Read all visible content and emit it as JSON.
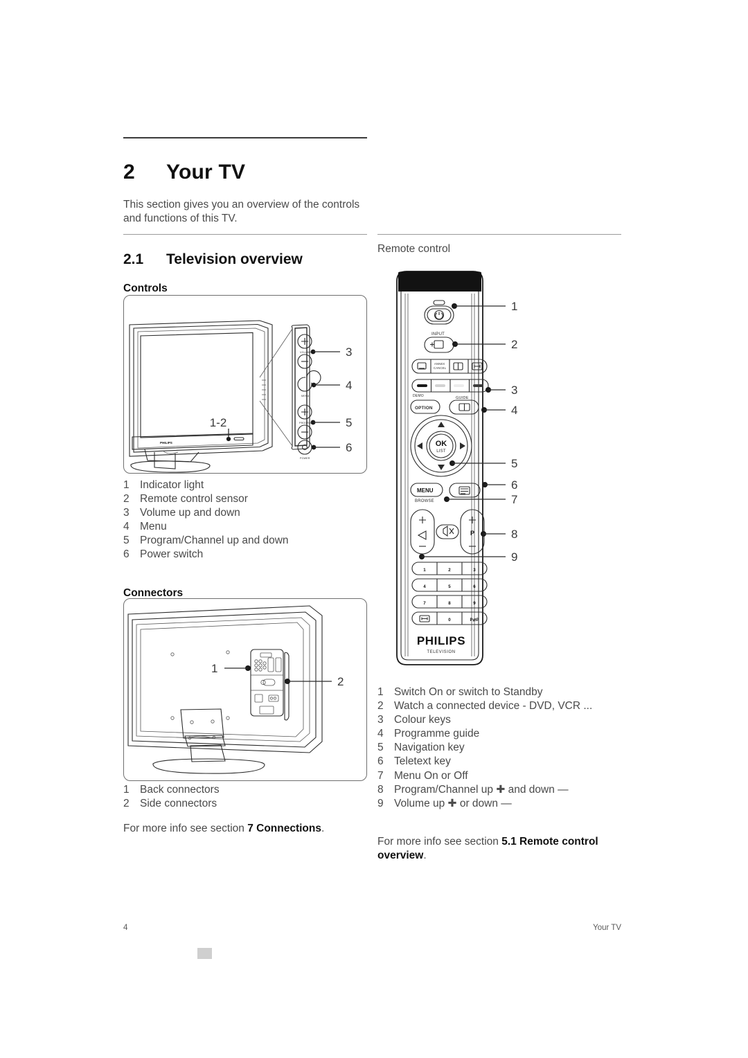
{
  "document": {
    "chapter_number": "2",
    "chapter_title": "Your TV",
    "intro": "This section gives you an overview of the controls and functions of this TV.",
    "section_number": "2.1",
    "section_title": "Television overview"
  },
  "left_column": {
    "controls_heading": "Controls",
    "connectors_heading": "Connectors",
    "controls_figure": {
      "brand": "PHILIPS",
      "callout_group_label": "1-2",
      "button_labels": [
        "VOLUME",
        "MENU",
        "PROGRAM",
        "POWER"
      ],
      "callouts": [
        "3",
        "4",
        "5",
        "6"
      ]
    },
    "connectors_figure": {
      "callouts": [
        "1",
        "2"
      ]
    },
    "controls_list": [
      {
        "num": "1",
        "label": "Indicator light"
      },
      {
        "num": "2",
        "label": "Remote control sensor"
      },
      {
        "num": "3",
        "label": "Volume up and down"
      },
      {
        "num": "4",
        "label": "Menu"
      },
      {
        "num": "5",
        "label": "Program/Channel up and down"
      },
      {
        "num": "6",
        "label": "Power switch"
      }
    ],
    "connectors_list": [
      {
        "num": "1",
        "label": "Back connectors"
      },
      {
        "num": "2",
        "label": "Side connectors"
      }
    ],
    "connectors_seealso_prefix": "For more info see section ",
    "connectors_seealso_bold": "7 Connections",
    "connectors_seealso_suffix": "."
  },
  "right_column": {
    "remote_heading": "Remote control",
    "remote_figure": {
      "brand": "PHILIPS",
      "brand_sub": "TELEVISION",
      "ok_label": "OK",
      "ok_sub": "LIST",
      "input_label": "INPUT",
      "guide_label": "GUIDE",
      "option_label": "OPTION",
      "menu_label": "MENU",
      "browse_label": "BROWSE",
      "demo_label": "DEMO",
      "subtitle_key": "ANNEX",
      "cancel_key": "CANCEL",
      "program_letter": "P",
      "swap_key": "P⇄P",
      "numpad": [
        "1",
        "2",
        "3",
        "4",
        "5",
        "6",
        "7",
        "8",
        "9",
        "0"
      ],
      "callouts": [
        "1",
        "2",
        "3",
        "4",
        "5",
        "6",
        "7",
        "8",
        "9"
      ]
    },
    "remote_list": [
      {
        "num": "1",
        "label": "Switch On or switch to Standby"
      },
      {
        "num": "2",
        "label": "Watch a connected device - DVD, VCR ..."
      },
      {
        "num": "3",
        "label": "Colour keys"
      },
      {
        "num": "4",
        "label": "Programme guide"
      },
      {
        "num": "5",
        "label": "Navigation key"
      },
      {
        "num": "6",
        "label": "Teletext key"
      },
      {
        "num": "7",
        "label": "Menu On or Off"
      },
      {
        "num": "8",
        "label": "Program/Channel up ✚ and down —"
      },
      {
        "num": "9",
        "label": "Volume up ✚ or down —"
      }
    ],
    "remote_seealso_prefix": "For more info see section ",
    "remote_seealso_bold": "5.1 Remote control overview",
    "remote_seealso_suffix": "."
  },
  "footer": {
    "page_number": "4",
    "section_name": "Your TV"
  }
}
